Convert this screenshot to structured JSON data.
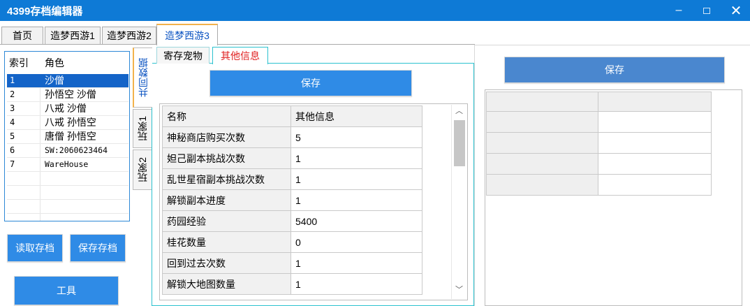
{
  "window": {
    "title": "4399存档编辑器",
    "minimize_glyph": "–",
    "close_glyph": "✕"
  },
  "top_tabs": [
    {
      "label": "首页"
    },
    {
      "label": "造梦西游1"
    },
    {
      "label": "造梦西游2"
    },
    {
      "label": "造梦西游3"
    }
  ],
  "save_list": {
    "headers": {
      "index": "索引",
      "role": "角色"
    },
    "rows": [
      {
        "index": "1",
        "role": "沙僧",
        "selected": true
      },
      {
        "index": "2",
        "role": "孙悟空 沙僧"
      },
      {
        "index": "3",
        "role": "八戒 沙僧"
      },
      {
        "index": "4",
        "role": "八戒 孙悟空"
      },
      {
        "index": "5",
        "role": "唐僧 孙悟空"
      },
      {
        "index": "6",
        "role": "SW:2060623464"
      },
      {
        "index": "7",
        "role": "WareHouse"
      }
    ]
  },
  "buttons": {
    "load": "读取存档",
    "save_archive": "保存存档",
    "tools": "工具",
    "save_mid": "保存",
    "save_right": "保存"
  },
  "vertical_tabs": [
    {
      "label": "共同数据"
    },
    {
      "label": "玩家1"
    },
    {
      "label": "玩家2"
    }
  ],
  "sub_tabs": [
    {
      "label": "寄存宠物"
    },
    {
      "label": "其他信息"
    }
  ],
  "info_table": {
    "headers": {
      "name": "名称",
      "value": "其他信息"
    },
    "rows": [
      {
        "name": "神秘商店购买次数",
        "value": "5"
      },
      {
        "name": "妲己副本挑战次数",
        "value": "1"
      },
      {
        "name": "乱世星宿副本挑战次数",
        "value": "1"
      },
      {
        "name": "解锁副本进度",
        "value": "1"
      },
      {
        "name": "药园经验",
        "value": "5400"
      },
      {
        "name": "桂花数量",
        "value": "0"
      },
      {
        "name": "回到过去次数",
        "value": "1"
      },
      {
        "name": "解锁大地图数量",
        "value": "1"
      }
    ]
  },
  "colors": {
    "titlebar": "#0e7ad6",
    "button": "#2f8be6",
    "selected_row": "#1464c8",
    "active_subtab_text": "#e02020",
    "panel_border": "#2bc2cf"
  },
  "icons": {
    "scroll_up": "scroll-up-arrow-icon",
    "scroll_down": "scroll-down-arrow-icon"
  }
}
